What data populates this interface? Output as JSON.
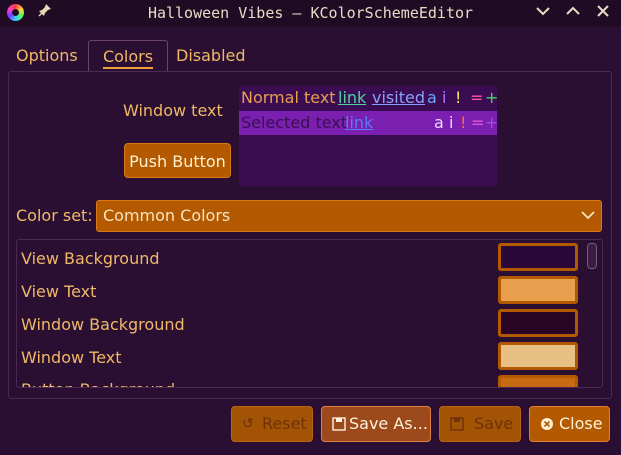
{
  "window": {
    "title": "Halloween Vibes — KColorSchemeEditor"
  },
  "titlebar_icons": {
    "app": "app-color-wheel-icon",
    "pin": "pin-icon",
    "minimize": "chevron-down-icon",
    "maximize": "chevron-up-icon",
    "close": "close-x-icon"
  },
  "tabs": [
    {
      "label": "Options"
    },
    {
      "label": "Colors",
      "active": true
    },
    {
      "label": "Disabled"
    }
  ],
  "preview": {
    "label": "Window text",
    "push_button": "Push Button",
    "normal_row": {
      "text": "Normal text",
      "link": "link",
      "visited": "visited",
      "a": "a",
      "i": "i",
      "bang": "!",
      "eq": "=",
      "plus": "+"
    },
    "selected_row": {
      "text": "Selected text",
      "link": "link",
      "a": "a",
      "i": "i",
      "bang": "!",
      "eq": "=",
      "plus": "+"
    }
  },
  "color_set": {
    "label": "Color set:",
    "value": "Common Colors"
  },
  "color_roles": [
    {
      "name": "View Background",
      "color": "#2a0838"
    },
    {
      "name": "View Text",
      "color": "#e8a04e"
    },
    {
      "name": "Window Background",
      "color": "#2a0626"
    },
    {
      "name": "Window Text",
      "color": "#e8c084"
    },
    {
      "name": "Button Background",
      "color": "#c86a14"
    }
  ],
  "buttons": {
    "reset": "Reset",
    "save_as": "Save As...",
    "save": "Save",
    "close": "Close"
  },
  "colors": {
    "accent": "#b35a00",
    "text": "#f0b866",
    "window_bg": "#2a0f33",
    "selection_bg": "#7a1fb0",
    "link": "#4fd2a0",
    "visited": "#8aa0ff"
  }
}
